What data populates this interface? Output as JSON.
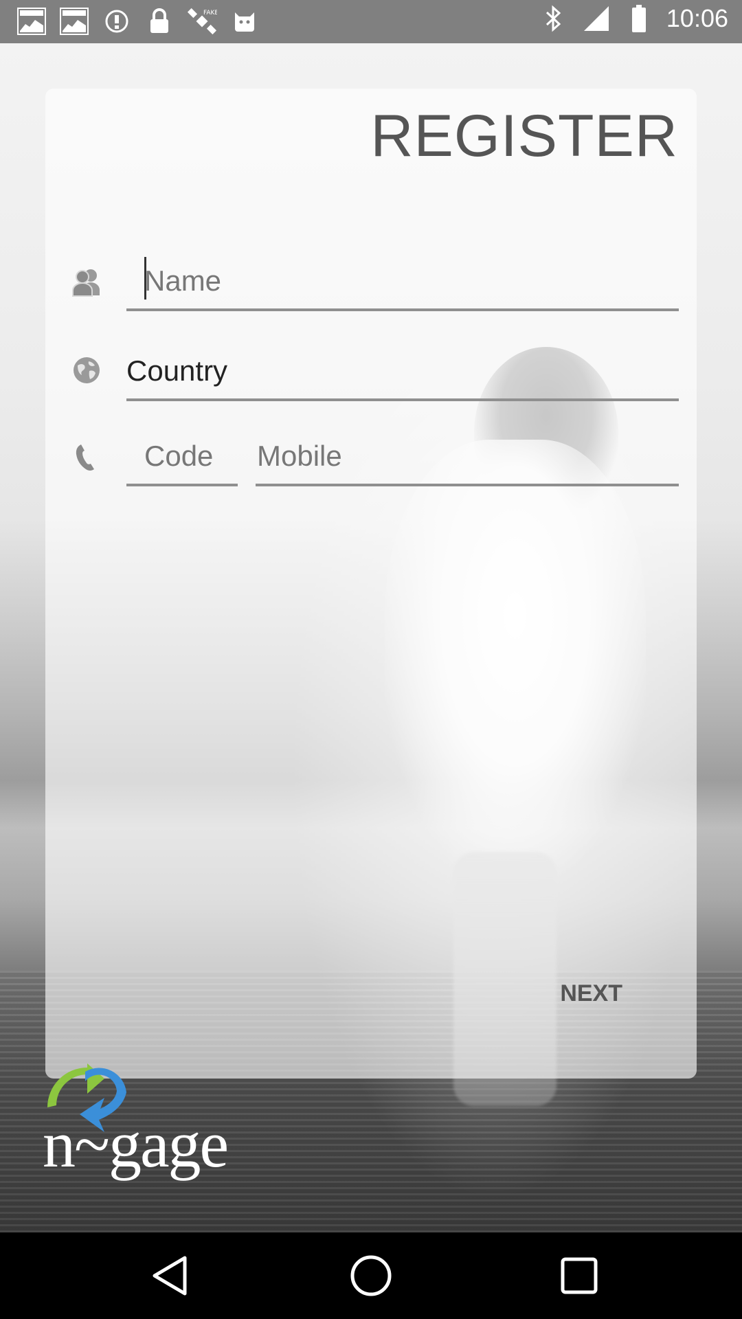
{
  "status_bar": {
    "time": "10:06",
    "icons": [
      "ifl-markets-icon",
      "ifl-markets-icon",
      "info-icon",
      "lock-icon",
      "satellite-icon",
      "cat-icon",
      "bluetooth-icon",
      "signal-icon",
      "battery-icon"
    ]
  },
  "register": {
    "title": "REGISTER",
    "name_placeholder": "Name",
    "country_value": "Country",
    "code_placeholder": "Code",
    "mobile_placeholder": "Mobile",
    "next_label": "NEXT"
  },
  "logo": {
    "text": "n~gage",
    "colors": [
      "#8cc63f",
      "#3b8fd9"
    ]
  },
  "nav_bar": {
    "buttons": [
      "back-icon",
      "home-icon",
      "recents-icon"
    ]
  }
}
